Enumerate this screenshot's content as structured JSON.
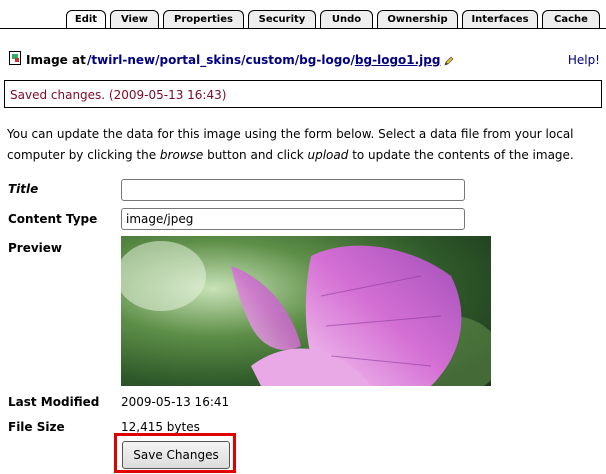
{
  "tabs": [
    {
      "label": "Edit",
      "active": true
    },
    {
      "label": "View",
      "active": false
    },
    {
      "label": "Properties",
      "active": false
    },
    {
      "label": "Security",
      "active": false
    },
    {
      "label": "Undo",
      "active": false
    },
    {
      "label": "Ownership",
      "active": false
    },
    {
      "label": "Interfaces",
      "active": false
    },
    {
      "label": "Cache",
      "active": false
    }
  ],
  "header": {
    "prefix": "Image at",
    "path": [
      "/twirl-new",
      "/portal_skins",
      "/custom",
      "/bg-logo",
      "/",
      "bg-logo1.jpg"
    ],
    "help": "Help!"
  },
  "status": "Saved changes. (2009-05-13 16:43)",
  "intro": {
    "part1": "You can update the data for this image using the form below. Select a data file from your local computer by clicking the ",
    "browse": "browse",
    "part2": " button and click ",
    "upload": "upload",
    "part3": " to update the contents of the image."
  },
  "form": {
    "title_label": "Title",
    "title_value": "",
    "content_type_label": "Content Type",
    "content_type_value": "image/jpeg",
    "preview_label": "Preview",
    "last_modified_label": "Last Modified",
    "last_modified_value": "2009-05-13 16:41",
    "file_size_label": "File Size",
    "file_size_value": "12,415 bytes",
    "save_label": "Save Changes"
  },
  "colors": {
    "status_text": "#7a0a2a",
    "link": "#000080",
    "highlight": "#e00000"
  }
}
